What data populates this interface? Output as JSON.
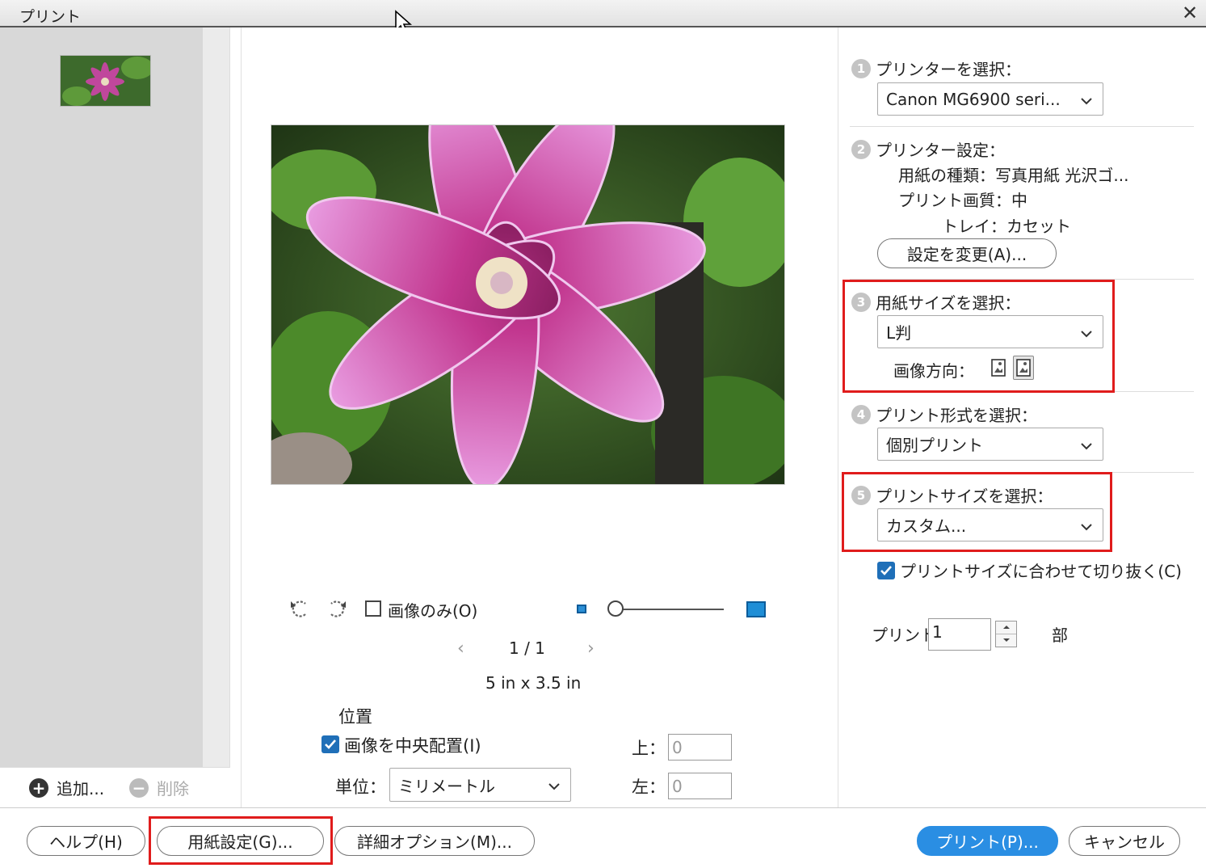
{
  "window": {
    "title": "プリント"
  },
  "left": {
    "add_label": "追加...",
    "delete_label": "削除"
  },
  "preview": {
    "image_only_label": "画像のみ(O)",
    "page_indicator": "1 / 1",
    "size_text": "5 in x 3.5 in",
    "position_label": "位置",
    "center_image_label": "画像を中央配置(I)",
    "center_image_checked": true,
    "unit_label": "単位：",
    "unit_value": "ミリメートル",
    "top_label": "上：",
    "top_value": "0",
    "left_label": "左：",
    "left_value": "0"
  },
  "settings": {
    "step1": {
      "num": "1",
      "label": "プリンターを選択：",
      "value": "Canon MG6900 seri..."
    },
    "step2": {
      "num": "2",
      "label": "プリンター設定：",
      "paper_type": "用紙の種類：写真用紙 光沢ゴ...",
      "quality": "プリント画質：中",
      "tray": "トレイ：カセット",
      "change_button": "設定を変更(A)..."
    },
    "step3": {
      "num": "3",
      "label": "用紙サイズを選択：",
      "value": "L判",
      "orientation_label": "画像方向："
    },
    "step4": {
      "num": "4",
      "label": "プリント形式を選択：",
      "value": "個別プリント"
    },
    "step5": {
      "num": "5",
      "label": "プリントサイズを選択：",
      "value": "カスタム..."
    },
    "crop_label": "プリントサイズに合わせて切り抜く(C)",
    "crop_checked": true,
    "copies_label": "プリント",
    "copies_value": "1",
    "copies_unit": "部"
  },
  "footer": {
    "help": "ヘルプ(H)",
    "paper_setup": "用紙設定(G)...",
    "advanced": "詳細オプション(M)...",
    "print": "プリント(P)...",
    "cancel": "キャンセル"
  },
  "colors": {
    "highlight_box": "#e01c1c",
    "primary_button": "#2a8ee3",
    "checkbox": "#1f6fb8"
  }
}
